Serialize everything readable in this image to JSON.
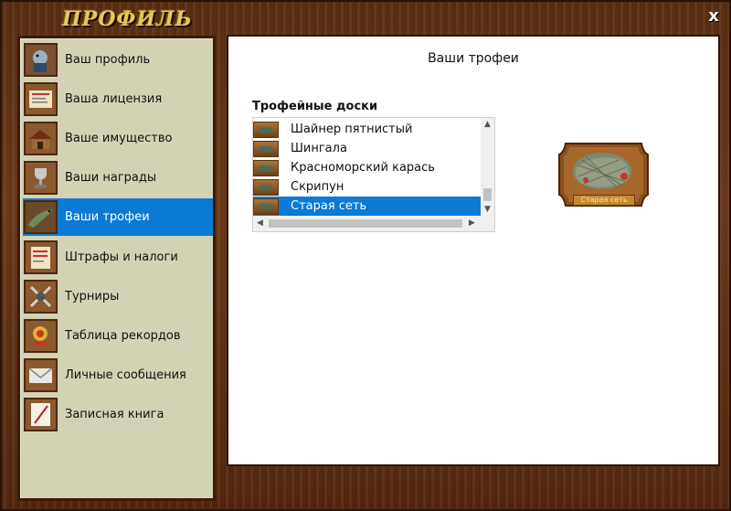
{
  "window": {
    "title": "ПРОФИЛЬ",
    "close_glyph": "x"
  },
  "sidebar": {
    "items": [
      {
        "label": "Ваш профиль",
        "icon": "fisherman-avatar-icon"
      },
      {
        "label": "Ваша лицензия",
        "icon": "license-document-icon"
      },
      {
        "label": "Ваше имущество",
        "icon": "property-house-icon"
      },
      {
        "label": "Ваши награды",
        "icon": "trophy-cup-icon"
      },
      {
        "label": "Ваши трофеи",
        "icon": "pike-fish-icon",
        "active": true
      },
      {
        "label": "Штрафы и налоги",
        "icon": "fines-paper-icon"
      },
      {
        "label": "Турниры",
        "icon": "tournament-crossed-swords-icon"
      },
      {
        "label": "Таблица рекордов",
        "icon": "records-medal-icon"
      },
      {
        "label": "Личные сообщения",
        "icon": "envelope-icon"
      },
      {
        "label": "Записная книга",
        "icon": "notebook-pencil-icon"
      }
    ]
  },
  "content": {
    "title": "Ваши трофеи",
    "boards_label": "Трофейные доски",
    "boards": [
      {
        "label": "Шайнер пятнистый"
      },
      {
        "label": "Шингала"
      },
      {
        "label": "Красноморский карась"
      },
      {
        "label": "Скрипун"
      },
      {
        "label": "Старая сеть",
        "selected": true
      }
    ],
    "preview": {
      "label": "Старая сеть"
    }
  },
  "colors": {
    "accent": "#0a7ad4",
    "sidebar_bg": "#d4d2b5",
    "wood": "#6e3a18",
    "title_gold": "#e8c65a"
  }
}
